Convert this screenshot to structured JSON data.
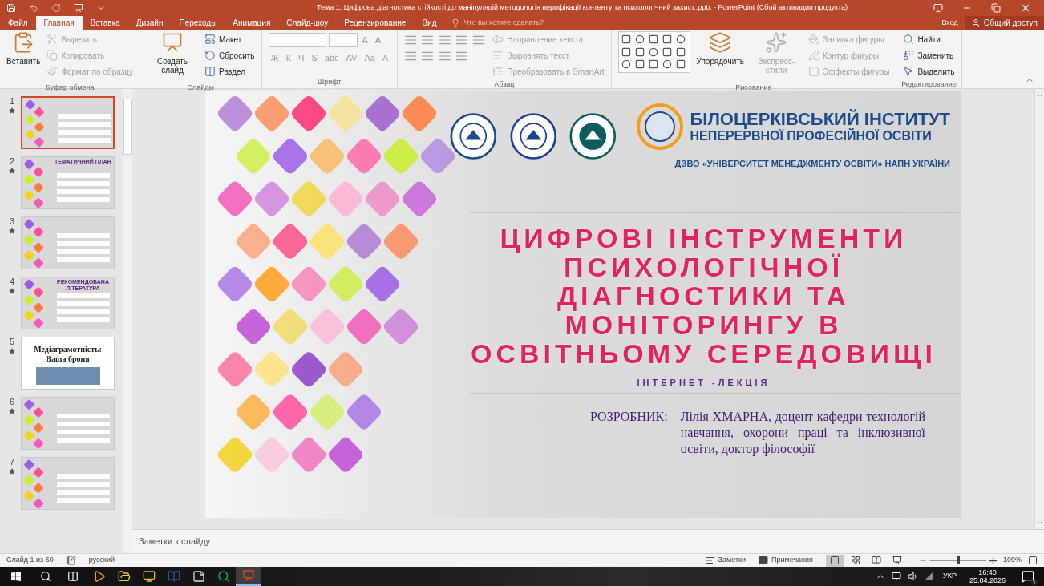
{
  "window": {
    "title": "Тема 1. Цифрова діагностика стійкості до маніпуляцій методологія верифікації контенту та психологічний захист..pptx - PowerPoint (Сбой активации продукта)"
  },
  "tabs": [
    {
      "label": "Файл",
      "selected": false
    },
    {
      "label": "Главная",
      "selected": true
    },
    {
      "label": "Вставка",
      "selected": false
    },
    {
      "label": "Дизайн",
      "selected": false
    },
    {
      "label": "Переходы",
      "selected": false
    },
    {
      "label": "Анимация",
      "selected": false
    },
    {
      "label": "Слайд-шоу",
      "selected": false
    },
    {
      "label": "Рецензирование",
      "selected": false
    },
    {
      "label": "Вид",
      "selected": false
    }
  ],
  "tell_me": "Что вы хотите сделать?",
  "sign_in": "Вход",
  "share": "Общий доступ",
  "ribbon": [
    {
      "label": "Буфер обмена",
      "kind": "columns",
      "items": [
        {
          "kind": "large",
          "label": "Вставить",
          "disabled": false
        },
        {
          "kind": "small",
          "label": "Вырезать",
          "disabled": true
        },
        {
          "kind": "small",
          "label": "Копировать",
          "disabled": true
        },
        {
          "kind": "small",
          "label": "Формат по образцу",
          "disabled": true
        }
      ]
    },
    {
      "label": "Слайды",
      "kind": "columns",
      "items": [
        {
          "kind": "large",
          "label": "Создать слайд",
          "disabled": false
        },
        {
          "kind": "small",
          "label": "Макет",
          "disabled": false
        },
        {
          "kind": "small",
          "label": "Сбросить",
          "disabled": false
        },
        {
          "kind": "small",
          "label": "Раздел",
          "disabled": false
        }
      ]
    },
    {
      "label": "Шрифт",
      "kind": "font",
      "upper": [
        "A",
        "A"
      ],
      "lower": [
        "Ж",
        "К",
        "Ч",
        "S",
        "abc",
        "AV",
        "Aa",
        "A"
      ]
    },
    {
      "label": "Абзац",
      "kind": "columns",
      "items": [
        {
          "kind": "paragraph_buttons"
        },
        {
          "kind": "small",
          "label": "Направление текста",
          "disabled": true
        },
        {
          "kind": "small",
          "label": "Выровнять текст",
          "disabled": true
        },
        {
          "kind": "small",
          "label": "Преобразовать в SmartArt",
          "disabled": true
        }
      ]
    },
    {
      "label": "Рисование",
      "kind": "columns",
      "items": [
        {
          "kind": "shapes_gallery"
        },
        {
          "kind": "large",
          "label": "Упорядочить",
          "disabled": false
        },
        {
          "kind": "large",
          "label": "Экспресс-стили",
          "disabled": true
        },
        {
          "kind": "small",
          "label": "Заливка фигуры",
          "disabled": true
        },
        {
          "kind": "small",
          "label": "Контур фигуры",
          "disabled": true
        },
        {
          "kind": "small",
          "label": "Эффекты фигуры",
          "disabled": true
        }
      ]
    },
    {
      "label": "Редактирование",
      "kind": "columns",
      "items": [
        {
          "kind": "small",
          "label": "Найти",
          "disabled": false
        },
        {
          "kind": "small",
          "label": "Заменить",
          "disabled": false
        },
        {
          "kind": "small",
          "label": "Выделить",
          "disabled": false
        }
      ]
    }
  ],
  "slides": [
    {
      "number": "1",
      "selected": true,
      "kind": "art"
    },
    {
      "number": "2",
      "selected": false,
      "kind": "art",
      "title": "ТЕМАТИЧНИЙ ПЛАН"
    },
    {
      "number": "3",
      "selected": false,
      "kind": "art"
    },
    {
      "number": "4",
      "selected": false,
      "kind": "art",
      "title": "РЕКОМЕНДОВАНА ЛІТЕРАТУРА"
    },
    {
      "number": "5",
      "selected": false,
      "kind": "photo",
      "title": "Медіаграмотність: Ваша броня"
    },
    {
      "number": "6",
      "selected": false,
      "kind": "art"
    },
    {
      "number": "7",
      "selected": false,
      "kind": "art"
    }
  ],
  "slide": {
    "institute": [
      "БІЛОЦЕРКІВСЬКИЙ ІНСТИТУТ",
      "НЕПЕРЕРВНОЇ ПРОФЕСІЙНОЇ ОСВІТИ"
    ],
    "university": "ДЗВО «УНІВЕРСИТЕТ МЕНЕДЖМЕНТУ ОСВІТИ» НАПН УКРАЇНИ",
    "title_lines": [
      "ЦИФРОВІ ІНСТРУМЕНТИ",
      "ПСИХОЛОГІЧНОЇ",
      "ДІАГНОСТИКИ ТА",
      "МОНІТОРИНГУ В",
      "ОСВІТНЬОМУ СЕРЕДОВИЩІ"
    ],
    "subtitle": "ІНТЕРНЕТ -ЛЕКЦІЯ",
    "author_label": "РОЗРОБНИК:",
    "author": "Лілія ХМАРНА, доцент кафедри технологій навчання, охорони праці та інклюзивної освіти, доктор філософії"
  },
  "notes_placeholder": "Заметки к слайду",
  "status_bar": {
    "slide_count": "Слайд 1 из 50",
    "language": "русский",
    "notes": "Заметки",
    "comments": "Примечания",
    "views": [
      {
        "kind": "normal",
        "selected": true
      },
      {
        "kind": "sorter",
        "selected": false
      },
      {
        "kind": "reading",
        "selected": false
      },
      {
        "kind": "show",
        "selected": false
      }
    ],
    "zoom": {
      "level": 0.5,
      "reading": "109%"
    }
  },
  "taskbar": {
    "apps": [
      {
        "kind": "media",
        "selected": false
      },
      {
        "kind": "files",
        "selected": false
      },
      {
        "kind": "clock24",
        "selected": false
      },
      {
        "kind": "word",
        "selected": false
      },
      {
        "kind": "j",
        "selected": false
      },
      {
        "kind": "browser",
        "selected": false
      },
      {
        "kind": "powerpoint",
        "selected": true
      }
    ],
    "language": "УКР",
    "time": "16:40",
    "date": "25.04.2026",
    "notification_count": "1"
  }
}
